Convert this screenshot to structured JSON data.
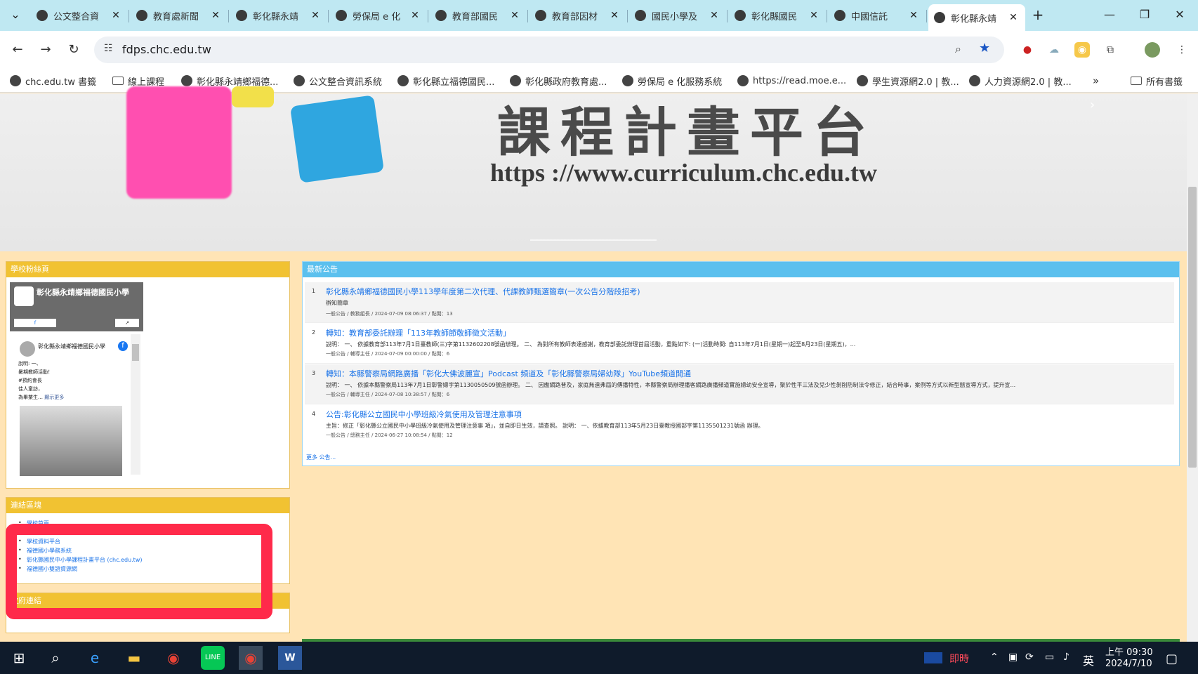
{
  "tabs": [
    {
      "label": "公文整合資",
      "icon": "globe-icon"
    },
    {
      "label": "教育處新聞",
      "icon": "cloud-icon"
    },
    {
      "label": "彰化縣永靖",
      "icon": "chc-logo-icon"
    },
    {
      "label": "勞保局 e 化",
      "icon": "labor-insurance-icon"
    },
    {
      "label": "教育部國民",
      "icon": "moe-leaf-icon"
    },
    {
      "label": "教育部因材",
      "icon": "adaptive-learning-icon"
    },
    {
      "label": "國民小學及",
      "icon": "tc-icon"
    },
    {
      "label": "彰化縣國民",
      "icon": "globe-icon"
    },
    {
      "label": "中國信託",
      "icon": "ctbc-icon"
    },
    {
      "label": "彰化縣永靖",
      "icon": "school-icon",
      "active": true
    }
  ],
  "address_bar": {
    "url": "fdps.chc.edu.tw"
  },
  "bookmarks": [
    {
      "label": "chc.edu.tw 書籤",
      "icon": "bookmark-site-icon"
    },
    {
      "label": "線上課程",
      "icon": "folder-icon"
    },
    {
      "label": "彰化縣永靖鄉福德...",
      "icon": "chc-logo-icon"
    },
    {
      "label": "公文整合資訊系統",
      "icon": "globe-icon"
    },
    {
      "label": "彰化縣立福德國民...",
      "icon": "school-icon"
    },
    {
      "label": "彰化縣政府教育處...",
      "icon": "cloud-icon"
    },
    {
      "label": "勞保局 e 化服務系統",
      "icon": "labor-insurance-icon"
    },
    {
      "label": "https://read.moe.e...",
      "icon": "globe-icon"
    },
    {
      "label": "學生資源網2.0 | 教...",
      "icon": "moe-leaf-icon"
    },
    {
      "label": "人力資源網2.0 | 教...",
      "icon": "moe-leaf-icon"
    }
  ],
  "all_bookmarks_label": "所有書籤",
  "banner": {
    "title": "課程計畫平台",
    "url": "https ://www.curriculum.chc.edu.tw"
  },
  "school_fan_page": {
    "header": "學校粉絲頁",
    "fb_title": "彰化縣永靖鄉福德國民小學",
    "post_author": "彰化縣永靖鄉福德國民小學",
    "post_lines": [
      "說明: 一、",
      "暑期教師活動！",
      "#預約會長",
      "佳人童訪，",
      "為畢業生…"
    ],
    "see_more": "顯示更多"
  },
  "news": {
    "header": "最新公告",
    "items": [
      {
        "num": "1",
        "title": "彰化縣永靖鄉福德國民小學113學年度第二次代理、代課教師甄選簡章(一次公告分階段招考)",
        "desc": "辦知簡章",
        "meta": "一般公告 / 教務組長 / 2024-07-09 08:06:37 / 點閱：13"
      },
      {
        "num": "2",
        "title": "轉知：教育部委託辦理「113年教師節敬師徵文活動」",
        "desc": "說明： 一、 依據教育部113年7月1日臺教師(三)字第1132602208號函辦理。 二、 為對所有教師表達感謝，教育部委託辦理首屆活動，重點如下: (一)活動時間: 自113年7月1日(星期一)起至8月23日(星期五)，...",
        "meta": "一般公告 / 輔導主任 / 2024-07-09 00:00:00 / 點閱：6"
      },
      {
        "num": "3",
        "title": "轉知：本縣警察局網路廣播「彰化大佛波麗宣」Podcast 頻道及「彰化縣警察局婦幼隊」YouTube頻道開通",
        "desc": "說明： 一、 依據本縣警察局113年7月1日彰警婦字第1130050509號函辦理。 二、 因應網路普及，家庭無遠弗屆的傳播特性，本縣警察局辦理播客網路廣播頻道實施婦幼安全宣導，聚於性平三法及兒少性剝削防制法令修正，結合時事，案例等方式以新型態宣導方式，提升宣...",
        "meta": "一般公告 / 輔導主任 / 2024-07-08 10:38:57 / 點閱：6"
      },
      {
        "num": "4",
        "title": "公告:彰化縣公立國民中小學班級冷氣使用及管理注意事項",
        "desc": "主旨：修正「彰化縣公立國民中小學班級冷氣使用及管理注意事 項」，並自即日生效，請查照。 說明： 一、依據教育部113年5月23日臺教授國部字第1135501231號函 辦理。",
        "meta": "一般公告 / 總務主任 / 2024-06-27 10:08:54 / 點閱：12"
      }
    ],
    "more": "更多 公告..."
  },
  "links": {
    "header": "連結區塊",
    "items": [
      "學校首頁",
      "學校資料平台",
      "福德國小學務系統",
      "彰化縣國民中小學課程計畫平台 (chc.edu.tw)",
      "福德國小雙語資源網"
    ],
    "gov_header": "政府連結"
  },
  "taskbar": {
    "news_label": "即時",
    "ime": "英",
    "time": "上午 09:30",
    "date": "2024/7/10"
  }
}
